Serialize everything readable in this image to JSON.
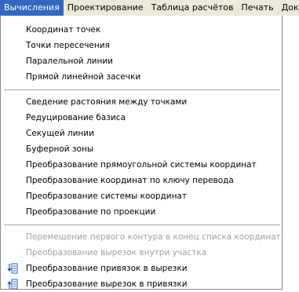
{
  "menubar": {
    "items": [
      {
        "label": "Вычисления",
        "active": true
      },
      {
        "label": "Проектирование",
        "active": false
      },
      {
        "label": "Таблица расчётов",
        "active": false
      },
      {
        "label": "Печать",
        "active": false
      },
      {
        "label": "Доку",
        "active": false
      }
    ]
  },
  "dropdown": {
    "group1": [
      {
        "label": "Координат точек"
      },
      {
        "label": "Точки пересечения"
      },
      {
        "label": "Паралельной линии"
      },
      {
        "label": "Прямой линейной засечки"
      }
    ],
    "group2": [
      {
        "label": "Сведение растояния между точками"
      },
      {
        "label": "Редуцирование базиса"
      },
      {
        "label": "Секущей линии"
      },
      {
        "label": "Буферной зоны"
      },
      {
        "label": "Преобразование прямоугольной системы координат"
      },
      {
        "label": "Преобразование координат по ключу перевода"
      },
      {
        "label": "Преобразование системы координат"
      },
      {
        "label": "Преобразование по проекции"
      }
    ],
    "group3": [
      {
        "label": "Перемещение первого контура в конец списка координат",
        "disabled": true
      },
      {
        "label": "Преобразование вырезок внутри участка",
        "disabled": true
      },
      {
        "label": "Преобразование привязок в вырезки",
        "icon": "convert-icon"
      },
      {
        "label": "Преобразование вырезок в привязки",
        "icon": "convert-icon"
      }
    ]
  },
  "colors": {
    "highlight": "#316ac5",
    "disabled_text": "#a0a0a0",
    "menubar_bg": "#ece9d8"
  }
}
